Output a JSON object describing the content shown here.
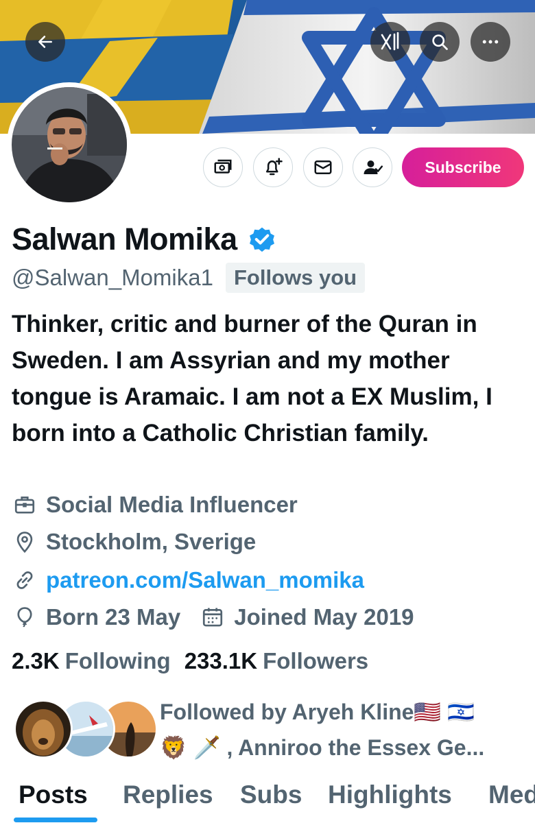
{
  "header": {
    "back_icon": "arrow-left-icon",
    "grok_icon": "grok-icon",
    "search_icon": "search-icon",
    "more_icon": "more-horizontal-icon"
  },
  "profile": {
    "display_name": "Salwan Momika",
    "verified_icon": "verified-badge-icon",
    "handle": "@Salwan_Momika1",
    "follows_you": "Follows you",
    "bio": "Thinker, critic and burner of the Quran in Sweden. I am Assyrian and my mother tongue is Aramaic. I am not a EX Muslim, I born into a Catholic Christian family."
  },
  "actions": {
    "money_icon": "money-icon",
    "notify_icon": "bell-plus-icon",
    "message_icon": "mail-icon",
    "following_icon": "person-check-icon",
    "subscribe_label": "Subscribe"
  },
  "meta": {
    "profession": "Social Media Influencer",
    "location": "Stockholm, Sverige",
    "website": "patreon.com/Salwan_momika",
    "birthday": "Born 23 May",
    "joined": "Joined May 2019"
  },
  "stats": {
    "following_count": "2.3K",
    "following_label": "Following",
    "followers_count": "233.1K",
    "followers_label": "Followers"
  },
  "followed_by": {
    "line1": "Followed by Aryeh Kline🇺🇸 🇮🇱",
    "line2": "🦁 🗡️ , Anniroo the Essex Ge..."
  },
  "tabs": [
    {
      "label": "Posts",
      "active": true
    },
    {
      "label": "Replies",
      "active": false
    },
    {
      "label": "Subs",
      "active": false
    },
    {
      "label": "Highlights",
      "active": false
    },
    {
      "label": "Media",
      "active": false
    }
  ],
  "colors": {
    "accent": "#1d9bf0",
    "subscribe_gradient_start": "#d61f9a",
    "subscribe_gradient_end": "#f0377a",
    "secondary_text": "#536471"
  }
}
